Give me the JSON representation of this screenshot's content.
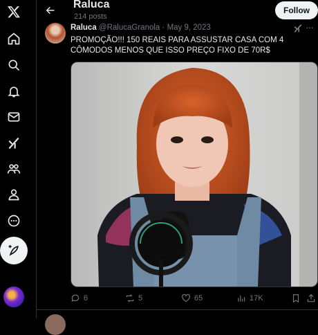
{
  "header": {
    "name": "Raluca",
    "posts": "214 posts",
    "follow_label": "Follow"
  },
  "tweet": {
    "name": "Raluca",
    "handle": "@RalucaGranola",
    "separator": "·",
    "date": "May 9, 2023",
    "text": "PROMOÇÃO!!! 150 REAIS PARA ASSUSTAR CASA COM 4 CÔMODOS MENOS QUE ISSO PREÇO FIXO DE 70R$",
    "actions": {
      "replies": "6",
      "reposts": "5",
      "likes": "65",
      "views": "17K"
    }
  },
  "sidebar": {
    "items": [
      "x-logo-icon",
      "home-icon",
      "search-icon",
      "notifications-icon",
      "messages-icon",
      "grok-icon",
      "communities-icon",
      "profile-icon",
      "more-icon"
    ]
  },
  "colors": {
    "background": "#000000",
    "text": "#e7e9ea",
    "muted": "#71767b",
    "border": "#2f3336",
    "button": "#eff3f4"
  }
}
